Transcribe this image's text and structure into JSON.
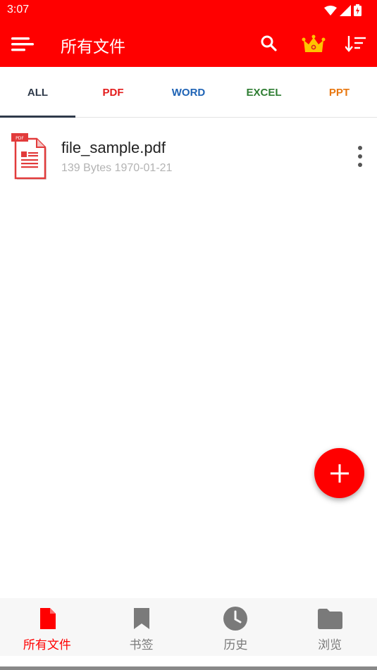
{
  "status_bar": {
    "time": "3:07",
    "icons": [
      "wifi-icon",
      "cellular-signal-icon",
      "battery-charging-icon"
    ]
  },
  "app_bar": {
    "title": "所有文件",
    "background_color": "#ff0000",
    "actions": [
      "search-icon",
      "crown-icon",
      "sort-icon"
    ]
  },
  "tabs": [
    {
      "label": "ALL",
      "color": "#2f3a4a",
      "active": true
    },
    {
      "label": "PDF",
      "color": "#e31b1b",
      "active": false
    },
    {
      "label": "WORD",
      "color": "#1e63b5",
      "active": false
    },
    {
      "label": "EXCEL",
      "color": "#2e7d32",
      "active": false
    },
    {
      "label": "PPT",
      "color": "#e8770f",
      "active": false
    }
  ],
  "files": [
    {
      "name": "file_sample.pdf",
      "meta": "139 Bytes 1970-01-21",
      "type": "PDF"
    }
  ],
  "fab": {
    "icon": "plus-icon"
  },
  "bottom_nav": [
    {
      "label": "所有文件",
      "icon": "file-icon",
      "active": true,
      "color": "#ff0000"
    },
    {
      "label": "书签",
      "icon": "bookmark-icon",
      "active": false,
      "color": "#7a7a7a"
    },
    {
      "label": "历史",
      "icon": "clock-icon",
      "active": false,
      "color": "#7a7a7a"
    },
    {
      "label": "浏览",
      "icon": "folder-icon",
      "active": false,
      "color": "#7a7a7a"
    }
  ]
}
